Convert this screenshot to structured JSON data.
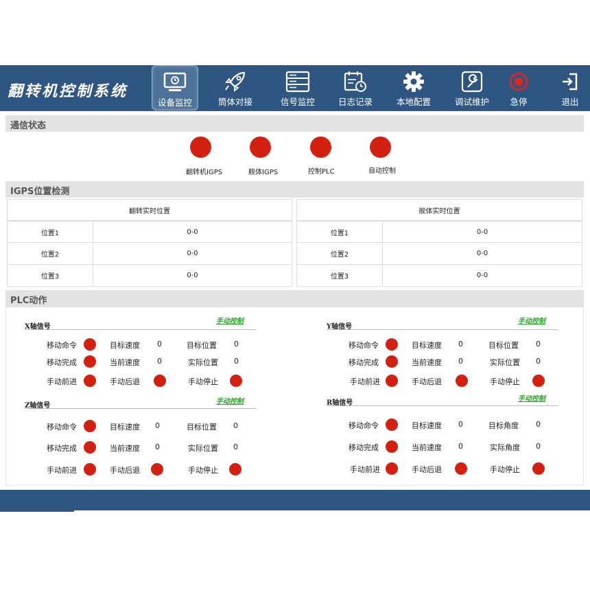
{
  "app": {
    "title": "翻转机控制系统"
  },
  "nav": [
    {
      "label": "设备监控",
      "icon": "monitor-icon"
    },
    {
      "label": "筒体对接",
      "icon": "rocket-icon"
    },
    {
      "label": "信号监控",
      "icon": "server-icon"
    },
    {
      "label": "日志记录",
      "icon": "calendar-icon"
    },
    {
      "label": "本地配置",
      "icon": "gear-icon"
    },
    {
      "label": "调试维护",
      "icon": "wrench-icon"
    },
    {
      "label": "急停",
      "icon": "stop-icon"
    },
    {
      "label": "退出",
      "icon": "exit-icon"
    }
  ],
  "comm": {
    "title": "通信状态",
    "items": [
      {
        "label": "翻转机IGPS"
      },
      {
        "label": "舰体IGPS"
      },
      {
        "label": "控制PLC"
      },
      {
        "label": "自动控制"
      }
    ]
  },
  "igps": {
    "title": "IGPS位置检测",
    "tables": [
      {
        "header": "翻转实时位置",
        "rows": [
          {
            "name": "位置1",
            "value": "0-0"
          },
          {
            "name": "位置2",
            "value": "0-0"
          },
          {
            "name": "位置3",
            "value": "0-0"
          }
        ]
      },
      {
        "header": "舰体实时位置",
        "rows": [
          {
            "name": "位置1",
            "value": "0-0"
          },
          {
            "name": "位置2",
            "value": "0-0"
          },
          {
            "name": "位置3",
            "value": "0-0"
          }
        ]
      }
    ]
  },
  "plc": {
    "title": "PLC动作",
    "manual_label": "手动控制",
    "labels": {
      "move_cmd": "移动命令",
      "target_speed": "目标速度",
      "target_pos": "目标位置",
      "move_done": "移动完成",
      "current_speed": "当前速度",
      "actual_pos": "实际位置",
      "fwd": "手动前进",
      "back": "手动后退",
      "stop": "手动停止",
      "target_angle": "目标角度",
      "actual_angle": "实际角度"
    },
    "axes": [
      {
        "title": "X轴信号",
        "target_speed": "0",
        "target_pos": "0",
        "current_speed": "0",
        "actual_pos": "0"
      },
      {
        "title": "Y轴信号",
        "target_speed": "0",
        "target_pos": "0",
        "current_speed": "0",
        "actual_pos": "0"
      },
      {
        "title": "Z轴信号",
        "target_speed": "0",
        "target_pos": "0",
        "current_speed": "0",
        "actual_pos": "0"
      },
      {
        "title": "R轴信号",
        "target_speed": "0",
        "target_pos": "0",
        "current_speed": "0",
        "actual_pos": "0"
      }
    ]
  },
  "colors": {
    "primary": "#2f5680",
    "lamp": "#d42010",
    "link": "#2ea02e",
    "section": "#e3e3e3"
  }
}
